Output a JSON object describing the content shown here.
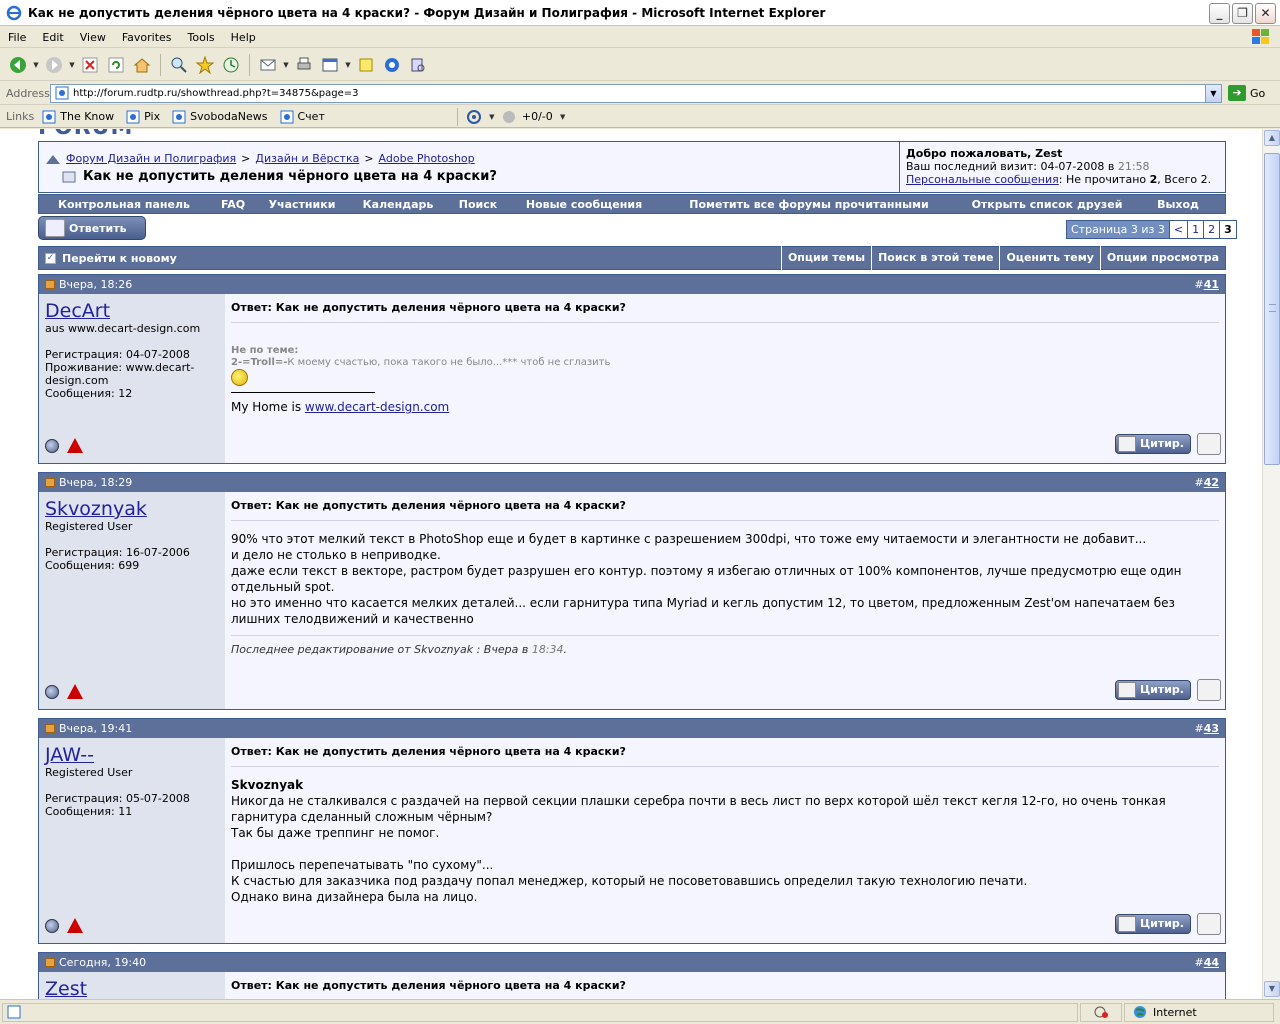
{
  "window": {
    "title": "Как не допустить деления чёрного цвета на 4 краски? - Форум Дизайн и Полиграфия - Microsoft Internet Explorer",
    "min": "_",
    "max": "❐",
    "close": "✕"
  },
  "menu": [
    "File",
    "Edit",
    "View",
    "Favorites",
    "Tools",
    "Help"
  ],
  "address": {
    "label": "Address",
    "url": "http://forum.rudtp.ru/showthread.php?t=34875&page=3",
    "go": "Go"
  },
  "links": {
    "label": "Links",
    "items": [
      "The Know",
      "Pix",
      "SvobodaNews",
      "Счет"
    ],
    "counter": "+0/-0"
  },
  "status": {
    "zone": "Internet"
  },
  "forum": {
    "logo_text": "FORUM",
    "breadcrumb": [
      "Форум Дизайн и Полиграфия",
      "Дизайн и Вёрстка",
      "Adobe Photoshop"
    ],
    "separator": ">",
    "thread_title": "Как не допустить деления чёрного цвета на 4 краски?",
    "welcome": {
      "greeting": "Добро пожаловать, Zest",
      "last_visit_label": "Ваш последний визит: 04-07-2008 в",
      "last_visit_time": "21:58",
      "pm_link": "Персональные сообщения",
      "pm_unread_label": ": Не прочитано",
      "pm_unread": "2",
      "pm_total_label": ", Всего",
      "pm_total": "2."
    },
    "navlinks": [
      "Контрольная панель",
      "FAQ",
      "Участники",
      "Календарь",
      "Поиск",
      "Новые сообщения",
      "Пометить все форумы прочитанными",
      "Открыть список друзей",
      "Выход"
    ],
    "reply_button": "Ответить",
    "pagenav": {
      "label": "Страница 3 из 3",
      "prev": "<",
      "pages": [
        "1",
        "2",
        "3"
      ],
      "current": "3"
    },
    "threadbar": {
      "first_unread": "Перейти к новому",
      "options": [
        "Опции темы",
        "Поиск в этой теме",
        "Оценить тему",
        "Опции просмотра"
      ]
    },
    "quote_label": "Цитир.",
    "posts": [
      {
        "date": "Вчера, 18:26",
        "num_prefix": "#",
        "num": "41",
        "user": "DecArt",
        "title": "aus www.decart-design.com",
        "reg": "Регистрация: 04-07-2008",
        "location": "Проживание: www.decart-design.com",
        "messages": "Сообщения: 12",
        "subject": "Ответ: Как не допустить деления чёрного цвета на 4 краски?",
        "quote_head": "Не по теме:",
        "quote_user": "2-=Troll=-",
        "quote_text": "К моему счастью, пока такого не было...*** чтоб не сглазить",
        "sig_prefix": "My Home is ",
        "sig_link": "www.decart-design.com"
      },
      {
        "date": "Вчера, 18:29",
        "num_prefix": "#",
        "num": "42",
        "user": "Skvoznyak",
        "title": "Registered User",
        "reg": "Регистрация: 16-07-2006",
        "messages": "Сообщения: 699",
        "subject": "Ответ: Как не допустить деления чёрного цвета на 4 краски?",
        "lines": [
          "90% что этот мелкий текст в PhotoShop еще и будет в картинке с разрешением 300dpi, что тоже ему читаемости и элегантности не добавит...",
          "и дело не столько в неприводке.",
          "даже если текст в векторе, растром будет разрушен его контур. поэтому я избегаю отличных от 100% компонентов, лучше предусмотрю еще один отдельный spot.",
          "но это именно что касается мелких деталей... если гарнитура типа Myriad и кегль допустим 12, то цветом, предложенным Zest'ом напечатаем без лишних телодвижений и качественно"
        ],
        "edit_prefix": "Последнее редактирование от Skvoznyak : Вчера в",
        "edit_time": "18:34",
        "edit_suffix": "."
      },
      {
        "date": "Вчера, 19:41",
        "num_prefix": "#",
        "num": "43",
        "user": "JAW--",
        "title": "Registered User",
        "reg": "Регистрация: 05-07-2008",
        "messages": "Сообщения: 11",
        "subject": "Ответ: Как не допустить деления чёрного цвета на 4 краски?",
        "addressee": "Skvoznyak",
        "lines": [
          "Никогда не сталкивался с раздачей на первой секции плашки серебра почти в весь лист по верх которой шёл текст кегля 12-го, но очень тонкая гарнитура сделанный сложным чёрным?",
          "Так бы даже треппинг не помог.",
          "",
          "Пришлось перепечатывать \"по сухому\"...",
          "К счастью для заказчика под раздачу попал менеджер, который не посоветовавшись определил такую технологию печати.",
          "Однако вина дизайнера была на лицо."
        ]
      },
      {
        "date": "Сегодня, 19:40",
        "num_prefix": "#",
        "num": "44",
        "user": "Zest",
        "subject": "Ответ: Как не допустить деления чёрного цвета на 4 краски?"
      }
    ]
  }
}
